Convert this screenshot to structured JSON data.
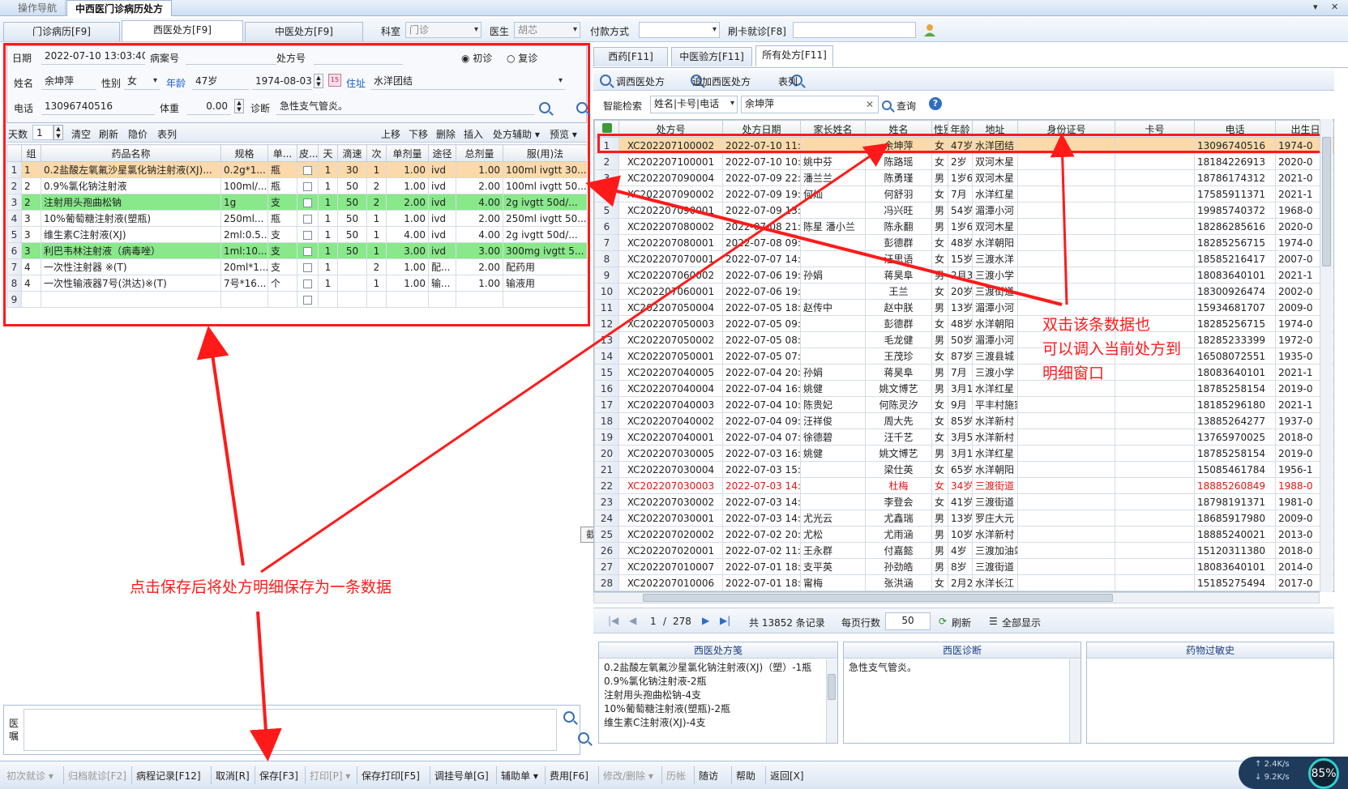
{
  "nav_tabs": [
    "操作导航",
    "中西医门诊病历处方"
  ],
  "window_close": "✕",
  "window_dropdown": "▾",
  "main_tabs": [
    "门诊病历[F9]",
    "西医处方[F9]",
    "中医处方[F9]"
  ],
  "header": {
    "dept_label": "科室",
    "dept_value": "门诊",
    "doctor_label": "医生",
    "doctor_value": "胡芯",
    "pay_label": "付款方式",
    "pay_value": "",
    "card_label": "刷卡就诊[F8]",
    "card_value": ""
  },
  "form": {
    "date_label": "日期",
    "date_value": "2022-07-10 13:03:40",
    "case_label": "病案号",
    "case_value": "",
    "rx_label": "处方号",
    "rx_value": "",
    "first_visit": "初诊",
    "return_visit": "复诊",
    "name_label": "姓名",
    "name_value": "余坤萍",
    "sex_label": "性别",
    "sex_value": "女",
    "age_label": "年龄",
    "age_value": "47岁",
    "dob_value": "1974-08-03",
    "addr_label": "住址",
    "addr_value": "水洋团结",
    "phone_label": "电话",
    "phone_value": "13096740516",
    "weight_label": "体重",
    "weight_value": "0.00",
    "diag_label": "诊断",
    "diag_value": "急性支气管炎。"
  },
  "left_toolbar": {
    "days_label": "天数",
    "days_value": "1",
    "buttons": [
      "清空",
      "刷新",
      "隐价",
      "表列"
    ],
    "right_buttons": [
      "上移",
      "下移",
      "删除",
      "插入",
      "处方辅助 ▾",
      "预览 ▾"
    ]
  },
  "rx_table": {
    "columns": [
      "组",
      "药品名称",
      "规格",
      "单...",
      "皮...",
      "天",
      "滴速",
      "次",
      "单剂量",
      "途径",
      "总剂量",
      "服(用)法"
    ],
    "rows": [
      [
        "1",
        "1",
        "0.2盐酸左氧氟沙星氯化钠注射液(XJ)...",
        "0.2g*1...",
        "瓶",
        "",
        "1",
        "30",
        "1",
        "1.00",
        "ivd",
        "1.00",
        "100ml ivgtt 30..."
      ],
      [
        "2",
        "2",
        "0.9%氯化钠注射液",
        "100ml/...",
        "瓶",
        "",
        "1",
        "50",
        "2",
        "1.00",
        "ivd",
        "2.00",
        "100ml ivgtt 50..."
      ],
      [
        "3",
        "2",
        "注射用头孢曲松钠",
        "1g",
        "支",
        "",
        "1",
        "50",
        "2",
        "2.00",
        "ivd",
        "4.00",
        "2g ivgtt 50d/..."
      ],
      [
        "4",
        "3",
        "10%葡萄糖注射液(塑瓶)",
        "250ml...",
        "瓶",
        "",
        "1",
        "50",
        "1",
        "1.00",
        "ivd",
        "2.00",
        "250ml ivgtt 50..."
      ],
      [
        "5",
        "3",
        "维生素C注射液(XJ)",
        "2ml:0.5...",
        "支",
        "",
        "1",
        "50",
        "1",
        "4.00",
        "ivd",
        "4.00",
        "2g ivgtt 50d/..."
      ],
      [
        "6",
        "3",
        "利巴韦林注射液（病毒唑）",
        "1ml:10...",
        "支",
        "",
        "1",
        "50",
        "1",
        "3.00",
        "ivd",
        "3.00",
        "300mg ivgtt 5..."
      ],
      [
        "7",
        "4",
        "一次性注射器 ※(T)",
        "20ml*1...",
        "支",
        "",
        "1",
        "",
        "2",
        "1.00",
        "配...",
        "2.00",
        "配药用"
      ],
      [
        "8",
        "4",
        "一次性输液器7号(洪达)※(T)",
        "7号*16...",
        "个",
        "",
        "1",
        "",
        "1",
        "1.00",
        "输...",
        "1.00",
        "输液用"
      ],
      [
        "9",
        "",
        "",
        "",
        "",
        "",
        "",
        "",
        "",
        "",
        "",
        "",
        ""
      ]
    ]
  },
  "annotations": {
    "left": "点击保存后将处方明细保存为一条数据",
    "right": [
      "双击该条数据也",
      "可以调入当前处方到",
      "明细窗口"
    ]
  },
  "tooltip": "截图(Alt + A)",
  "medical_advice_label": "医嘱",
  "right_tabs": [
    "西药[F11]",
    "中医验方[F11]",
    "所有处方[F11]"
  ],
  "right_toolbar": [
    "调西医处方",
    "追加西医处方",
    "表列"
  ],
  "smart_search": {
    "label": "智能检索",
    "mode": "姓名|卡号|电话",
    "value": "余坤萍",
    "clear": "✕",
    "button": "查询",
    "help": "?"
  },
  "history_table": {
    "columns": [
      "处方号",
      "处方日期",
      "家长姓名",
      "姓名",
      "性别",
      "年龄",
      "地址",
      "身份证号",
      "卡号",
      "电话",
      "出生日"
    ],
    "rows": [
      [
        "1",
        "XC202207100002",
        "2022-07-10 11:28:3",
        "",
        "余坤萍",
        "女",
        "47岁",
        "水洋团结",
        "",
        "",
        "13096740516",
        "1974-0"
      ],
      [
        "2",
        "XC202207100001",
        "2022-07-10 10:39:3",
        "姚中芬",
        "陈路瑶",
        "女",
        "2岁",
        "双河木星",
        "",
        "",
        "18184226913",
        "2020-0"
      ],
      [
        "3",
        "XC202207090004",
        "2022-07-09 22:21:5",
        "潘兰兰",
        "陈勇瑾",
        "男",
        "1岁6月",
        "双河木星",
        "",
        "",
        "18786174312",
        "2021-0"
      ],
      [
        "4",
        "XC202207090002",
        "2022-07-09 19:30:4",
        "何灿",
        "何舒羽",
        "女",
        "7月",
        "水洋红星",
        "",
        "",
        "17585911371",
        "2021-1"
      ],
      [
        "5",
        "XC202207090001",
        "2022-07-09 13:46:3",
        "",
        "冯兴旺",
        "男",
        "54岁",
        "湄潭小河",
        "",
        "",
        "19985740372",
        "1968-0"
      ],
      [
        "6",
        "XC202207080002",
        "2022-07-08 21:49:3",
        "陈星 潘小兰",
        "陈永翻",
        "男",
        "1岁6月",
        "双河木星",
        "",
        "",
        "18286285616",
        "2020-0"
      ],
      [
        "7",
        "XC202207080001",
        "2022-07-08 09:31:3",
        "",
        "彭德群",
        "女",
        "48岁",
        "水洋朝阳",
        "",
        "",
        "18285256715",
        "1974-0"
      ],
      [
        "8",
        "XC202207070001",
        "2022-07-07 14:46:5",
        "",
        "汪思语",
        "女",
        "15岁",
        "三渡水洋",
        "",
        "",
        "18585216417",
        "2007-0"
      ],
      [
        "9",
        "XC202207060002",
        "2022-07-06 19:47:4",
        "孙娟",
        "蒋昊阜",
        "男",
        "2月3",
        "三渡小学",
        "",
        "",
        "18083640101",
        "2021-1"
      ],
      [
        "10",
        "XC202207060001",
        "2022-07-06 19:16:0",
        "",
        "王兰",
        "女",
        "20岁",
        "三渡街道",
        "",
        "",
        "18300926474",
        "2002-0"
      ],
      [
        "11",
        "XC202207050004",
        "2022-07-05 18:52:2",
        "赵传中",
        "赵中朕",
        "男",
        "13岁",
        "湄潭小河",
        "",
        "",
        "15934681707",
        "2009-0"
      ],
      [
        "12",
        "XC202207050003",
        "2022-07-05 09:14:5",
        "",
        "彭德群",
        "女",
        "48岁",
        "水洋朝阳",
        "",
        "",
        "18285256715",
        "1974-0"
      ],
      [
        "13",
        "XC202207050002",
        "2022-07-05 08:20:3",
        "",
        "毛龙健",
        "男",
        "50岁",
        "湄潭小河",
        "",
        "",
        "18285233399",
        "1972-0"
      ],
      [
        "14",
        "XC202207050001",
        "2022-07-05 07:39:0",
        "",
        "王茂珍",
        "女",
        "87岁",
        "三渡县城",
        "",
        "",
        "16508072551",
        "1935-0"
      ],
      [
        "15",
        "XC202207040005",
        "2022-07-04 20:58:3",
        "孙娟",
        "蒋昊阜",
        "男",
        "7月",
        "三渡小学",
        "",
        "",
        "18083640101",
        "2021-1"
      ],
      [
        "16",
        "XC202207040004",
        "2022-07-04 16:08:4",
        "姚健",
        "姚文博艺",
        "男",
        "3月1",
        "水洋红星",
        "",
        "",
        "18785258154",
        "2019-0"
      ],
      [
        "17",
        "XC202207040003",
        "2022-07-04 10:22:1",
        "陈贵妃",
        "何陈灵汐",
        "女",
        "9月",
        "平丰村施家",
        "",
        "",
        "18185296180",
        "2021-1"
      ],
      [
        "18",
        "XC202207040002",
        "2022-07-04 09:21:0",
        "汪祥俊",
        "周大先",
        "女",
        "85岁",
        "水洋新村",
        "",
        "",
        "13885264277",
        "1937-0"
      ],
      [
        "19",
        "XC202207040001",
        "2022-07-04 07:51:4",
        "徐德碧",
        "汪千艺",
        "女",
        "3月5",
        "水洋新村",
        "",
        "",
        "13765970025",
        "2018-0"
      ],
      [
        "20",
        "XC202207030005",
        "2022-07-03 16:21:0",
        "姚健",
        "姚文博艺",
        "男",
        "3月1",
        "水洋红星",
        "",
        "",
        "18785258154",
        "2019-0"
      ],
      [
        "21",
        "XC202207030004",
        "2022-07-03 15:07:0",
        "",
        "梁仕英",
        "女",
        "65岁",
        "水洋朝阳",
        "",
        "",
        "15085461784",
        "1956-1"
      ],
      [
        "22",
        "XC202207030003",
        "2022-07-03 14:08:4",
        "",
        "杜梅",
        "女",
        "34岁",
        "三渡街道",
        "",
        "",
        "18885260849",
        "1988-0"
      ],
      [
        "23",
        "XC202207030002",
        "2022-07-03 14:07:0",
        "",
        "李登会",
        "女",
        "41岁",
        "三渡街道",
        "",
        "",
        "18798191371",
        "1981-0"
      ],
      [
        "24",
        "XC202207030001",
        "2022-07-03 14:03:4",
        "尤光云",
        "尤鑫瑞",
        "男",
        "13岁",
        "罗庄大元",
        "",
        "",
        "18685917980",
        "2009-0"
      ],
      [
        "25",
        "XC202207020002",
        "2022-07-02 20:04:4",
        "尤松",
        "尤雨涵",
        "男",
        "10岁",
        "水洋新村",
        "",
        "",
        "18885240021",
        "2013-0"
      ],
      [
        "26",
        "XC202207020001",
        "2022-07-02 11:11:3",
        "王永群",
        "付嘉懿",
        "男",
        "4岁",
        "三渡加油站",
        "",
        "",
        "15120311380",
        "2018-0"
      ],
      [
        "27",
        "XC202207010007",
        "2022-07-01 18:53:2",
        "支平英",
        "孙劲皓",
        "男",
        "8岁",
        "三渡街道",
        "",
        "",
        "18083640101",
        "2014-0"
      ],
      [
        "28",
        "XC202207010006",
        "2022-07-01 18:01:2",
        "甯梅",
        "张洪涵",
        "女",
        "2月2",
        "水洋长江",
        "",
        "",
        "15185275494",
        "2017-0"
      ]
    ]
  },
  "pagination": {
    "current": "1",
    "separator": "/",
    "total_pages": "278",
    "total_records": "共 13852 条记录",
    "per_page_label": "每页行数",
    "per_page": "50",
    "refresh": "刷新",
    "show_all": "全部显示"
  },
  "info_boxes": {
    "rx_title": "西医处方笺",
    "rx_lines": [
      "0.2盐酸左氧氟沙星氯化钠注射液(XJ)（塑）-1瓶",
      "0.9%氯化钠注射液-2瓶",
      "注射用头孢曲松钠-4支",
      "10%葡萄糖注射液(塑瓶)-2瓶",
      "维生素C注射液(XJ)-4支"
    ],
    "diag_title": "西医诊断",
    "diag_text": "急性支气管炎。",
    "allergy_title": "药物过敏史",
    "allergy_text": ""
  },
  "bottom_buttons": [
    {
      "label": "初次就诊 ▾",
      "enabled": false
    },
    {
      "label": "归档就诊[F2]",
      "enabled": false
    },
    {
      "label": "病程记录[F12]",
      "enabled": true
    },
    {
      "label": "取消[R]",
      "enabled": true
    },
    {
      "label": "保存[F3]",
      "enabled": true
    },
    {
      "label": "打印[P] ▾",
      "enabled": false
    },
    {
      "label": "保存打印[F5]",
      "enabled": true
    },
    {
      "label": "调挂号单[G]",
      "enabled": true
    },
    {
      "label": "辅助单 ▾",
      "enabled": true
    },
    {
      "label": "费用[F6]",
      "enabled": true
    },
    {
      "label": "修改/删除 ▾",
      "enabled": false
    },
    {
      "label": "历帐",
      "enabled": false
    },
    {
      "label": "随访",
      "enabled": true
    },
    {
      "label": "帮助",
      "enabled": true
    },
    {
      "label": "返回[X]",
      "enabled": true
    }
  ],
  "network": {
    "up": "2.4K/s",
    "down": "9.2K/s",
    "percent": "85%"
  },
  "colors": {
    "selected_row": "#fbd9a8",
    "green_row": "#88e88a",
    "annotation": "#ff1a1a",
    "accent": "#1a5fd0"
  }
}
